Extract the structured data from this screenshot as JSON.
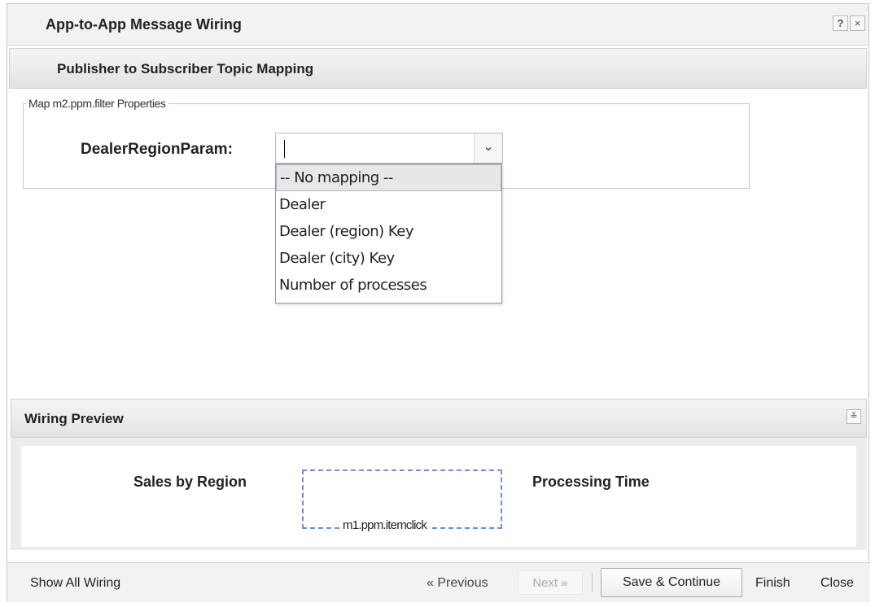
{
  "dialog": {
    "title": "App-to-App Message Wiring",
    "help_label": "?",
    "close_label": "×"
  },
  "section": {
    "title": "Publisher to Subscriber Topic Mapping"
  },
  "mapping": {
    "legend": "Map m2.ppm.filter Properties",
    "field_label": "DealerRegionParam:",
    "field_value": "",
    "dropdown_arrow": "⌄",
    "options": [
      "-- No mapping --",
      "Dealer",
      "Dealer (region) Key",
      "Dealer (city) Key",
      "Number of processes"
    ]
  },
  "preview": {
    "title": "Wiring Preview",
    "collapse_label": "≚",
    "publisher": "Sales by Region",
    "subscriber": "Processing Time",
    "event": "m1.ppm.itemclick"
  },
  "footer": {
    "show_all": "Show All Wiring",
    "previous": "« Previous",
    "next": "Next »",
    "save_continue": "Save & Continue",
    "finish": "Finish",
    "close": "Close"
  }
}
